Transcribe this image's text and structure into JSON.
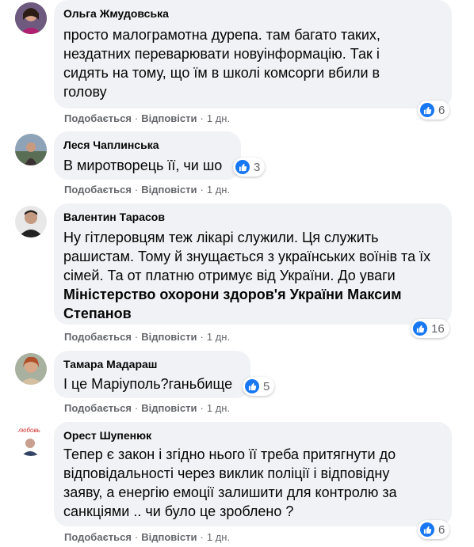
{
  "comments": [
    {
      "author": "Ольга Жмудовська",
      "lines": [
        "просто малограмотна дурепа. там багато таких,",
        "нездатних переварювати новуінформацію. Так і",
        "сидять на тому, що їм в школі комсорги вбили в",
        "голову"
      ],
      "reactions": "6"
    },
    {
      "author": "Леся Чаплинська",
      "lines": [
        "В миротворець її, чи шо"
      ],
      "reactions": "3"
    },
    {
      "author": "Валентин Тарасов",
      "lines": [
        "Ну гітлеровцям теж лікарі служили. Ця служить",
        "рашистам. Тому й знущається з українських воїнів та їх",
        "сімей. Та от платню отримує від України. До уваги"
      ],
      "bold_lines": [
        "Міністерство охорони здоров'я України Максим",
        "Степанов"
      ],
      "reactions": "16"
    },
    {
      "author": "Тамара Мадараш",
      "lines": [
        "І це Маріуполь?ганьбище"
      ],
      "reactions": "5"
    },
    {
      "author": "Орест Шупенюк",
      "lines": [
        "Тепер є закон і згідно нього її треба притягнути до",
        "відповідальності через виклик поліції і відповідну",
        "заяву, а енергію емоції залишити для контролю за",
        "санкціями .. чи було це зроблено ?"
      ],
      "reactions": "6",
      "avatar_badge": "любовь"
    }
  ],
  "actions": {
    "like": "Подобається",
    "reply": "Відповісти",
    "time": "1 дн.",
    "dot": "·"
  },
  "colors": {
    "bubble": "#f0f2f5",
    "like_blue": "#1877f2",
    "meta_gray": "#65676b"
  },
  "icons": {
    "reaction": "like-icon"
  }
}
